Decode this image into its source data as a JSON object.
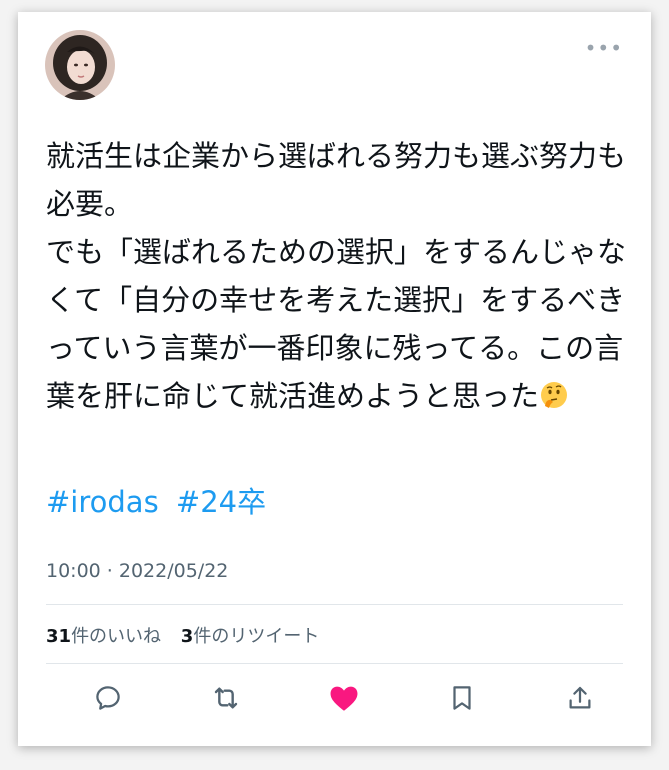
{
  "tweet": {
    "more_icon": "more-horizontal-icon",
    "avatar_icon": "user-avatar-photo",
    "text": "就活生は企業から選ばれる努力も選ぶ努力も必要。\nでも「選ばれるための選択」をするんじゃなくて「自分の幸せを考えた選択」をするべき っていう言葉が一番印象に残ってる。この言葉を肝に命じて就活進めようと思った",
    "emoji": "thinking-face-emoji",
    "hashtags": [
      "#irodas",
      "#24卒"
    ],
    "timestamp": "10:00 · 2022/05/22"
  },
  "stats": {
    "likes_count": "31",
    "likes_label": "件のいいね",
    "retweets_count": "3",
    "retweets_label": "件のリツイート"
  },
  "actions": [
    "reply-icon",
    "retweet-icon",
    "like-icon",
    "bookmark-icon",
    "share-icon"
  ],
  "colors": {
    "link": "#1d9bf0",
    "like": "#f91880",
    "text": "#0f1419",
    "secondary": "#536471"
  }
}
